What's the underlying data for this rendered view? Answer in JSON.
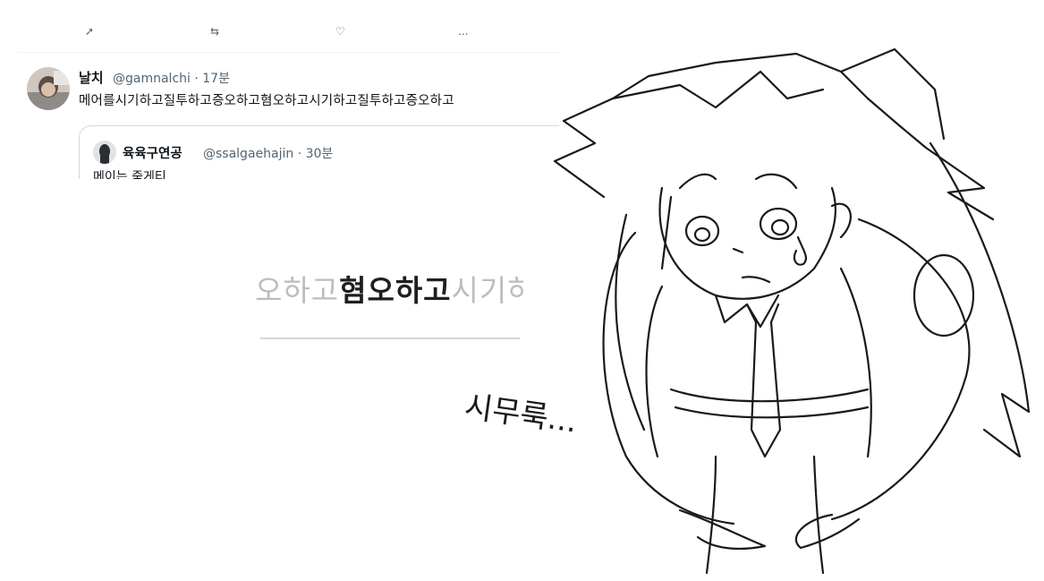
{
  "top_strip": {
    "more": "..."
  },
  "tweet": {
    "name": "날치",
    "handle_time": "@gamnalchi · 17분",
    "body": "메어를시기하고질투하고증오하고혐오하고시기하고질투하고증오하고"
  },
  "quote": {
    "name": "육육구연공",
    "handle_time": "@ssalgaehajin · 30분",
    "body": "메이는 죽게티"
  },
  "zoom": {
    "faded_left": "오하고",
    "highlight": "혐오하고",
    "faded_right": "시기하"
  },
  "drawing": {
    "caption": "시무룩..."
  }
}
